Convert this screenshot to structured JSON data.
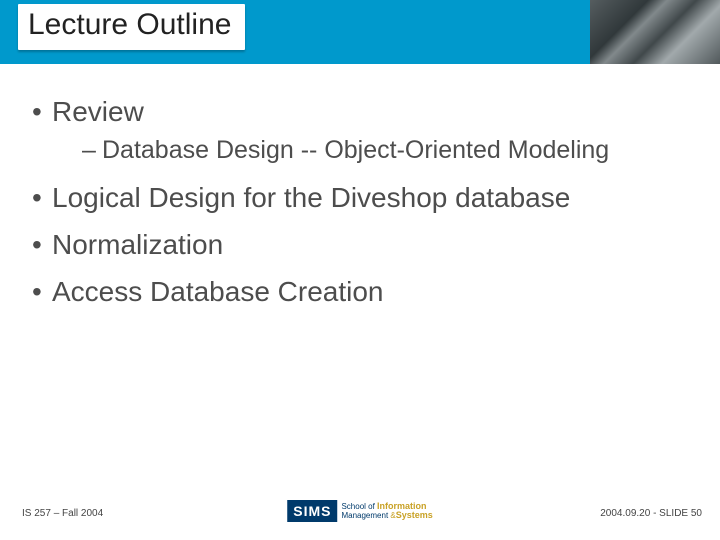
{
  "header": {
    "title": "Lecture Outline"
  },
  "content": {
    "bullets": [
      {
        "text": "Review",
        "sub": [
          "Database Design -- Object-Oriented Modeling"
        ]
      },
      {
        "text": "Logical Design for the Diveshop database"
      },
      {
        "text": "Normalization"
      },
      {
        "text": "Access Database Creation"
      }
    ]
  },
  "footer": {
    "left": "IS 257 – Fall 2004",
    "right": "2004.09.20 - SLIDE 50",
    "logo": {
      "block": "SIMS",
      "line1a": "School of ",
      "line1b": "Information",
      "line2a": "Management ",
      "line2amp": "&",
      "line2b": "Systems"
    }
  }
}
